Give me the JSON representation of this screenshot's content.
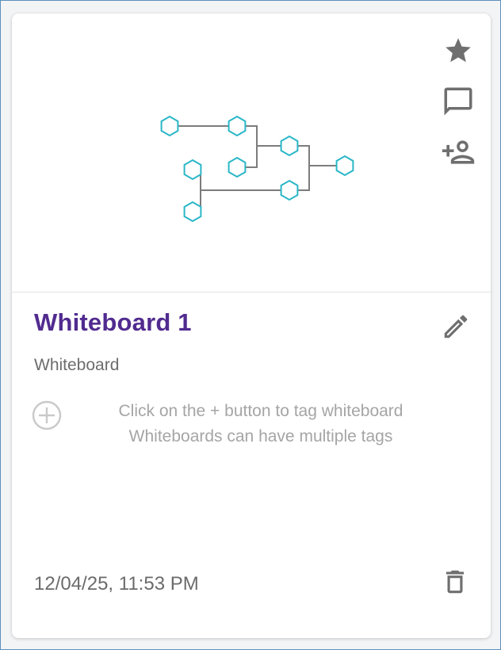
{
  "card": {
    "title": "Whiteboard 1",
    "type_label": "Whiteboard",
    "tag_hint": {
      "line1": "Click on the + button to tag whiteboard",
      "line2": "Whiteboards can have multiple tags"
    },
    "timestamp": "12/04/25, 11:53 PM"
  },
  "icons": {
    "favorite": "star-icon",
    "comments": "comment-icon",
    "share": "person-add-icon",
    "edit": "pencil-icon",
    "add_tag": "add-circle-icon",
    "delete": "trash-icon"
  },
  "colors": {
    "title": "#512b8f",
    "icon": "#6f6f6f",
    "diagram_node": "#2ab7c7",
    "diagram_line": "#7c7c7c"
  }
}
